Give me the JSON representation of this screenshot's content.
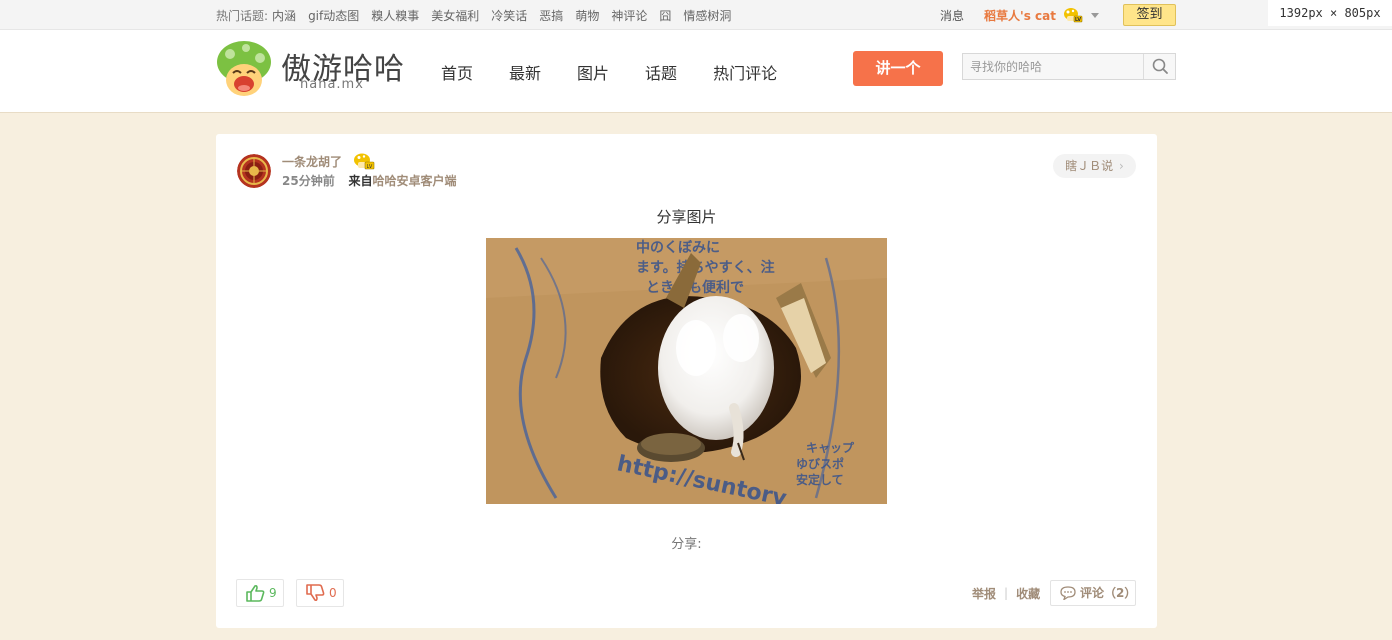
{
  "topbar": {
    "hot_label": "热门话题:",
    "hot_topics": [
      "内涵",
      "gif动态图",
      "糗人糗事",
      "美女福利",
      "冷笑话",
      "恶搞",
      "萌物",
      "神评论",
      "囧",
      "情感树洞"
    ],
    "messages": "消息",
    "username": "稻草人's cat",
    "checkin": "签到",
    "dim_label": "1392px × 805px"
  },
  "header": {
    "logo_text": "傲游哈哈",
    "logo_sub": "haha.mx",
    "nav": [
      "首页",
      "最新",
      "图片",
      "话题",
      "热门评论"
    ],
    "post_button": "讲一个",
    "search_placeholder": "寻找你的哈哈"
  },
  "post": {
    "author": "一条龙胡了",
    "time": "25分钟前",
    "from_label": "来自",
    "client": "哈哈安卓客户端",
    "jb_button": "瞎ＪＢ说",
    "title": "分享图片",
    "share_label": "分享:",
    "likes": "9",
    "dislikes": "0",
    "report": "举报",
    "favorite": "收藏",
    "comments": "评论（2）"
  },
  "colors": {
    "accent": "#f6724a",
    "page_bg": "#f7efdf",
    "username": "#e8793f",
    "link_brown": "#a08c78",
    "checkin_bg": "#ffe58a"
  }
}
